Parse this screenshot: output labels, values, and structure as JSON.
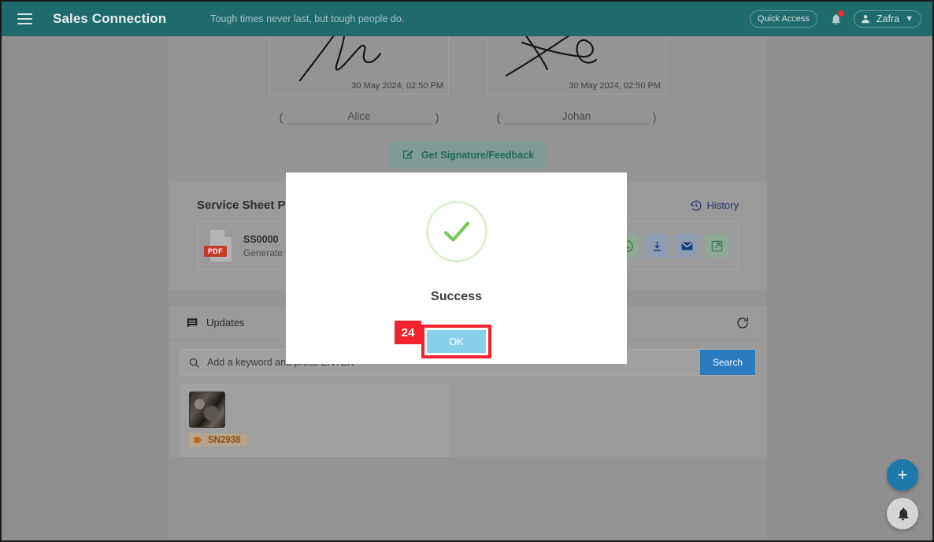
{
  "header": {
    "menu_icon": "hamburger-icon",
    "app_title": "Sales Connection",
    "quote": "Tough times never last, but tough people do.",
    "quick_access_label": "Quick Access",
    "bell_icon": "bell-icon",
    "user_name": "Zafra",
    "chevron": "⌄",
    "brand_color": "#1f6a6a"
  },
  "signatures": [
    {
      "timestamp": "30 May 2024, 02:50 PM",
      "name": "Alice",
      "open_paren": "(",
      "close_paren": ")"
    },
    {
      "timestamp": "30 May 2024, 02:50 PM",
      "name": "Johan",
      "open_paren": "(",
      "close_paren": ")"
    }
  ],
  "get_signature_button": {
    "label": "Get Signature/Feedback",
    "icon": "signature-edit-icon"
  },
  "service_sheet": {
    "title": "Service Sheet P",
    "history_label": "History",
    "history_icon": "history-clock-icon",
    "file": {
      "type_badge": "PDF",
      "name": "SS0000",
      "sub": "Generate",
      "actions": [
        {
          "name": "whatsapp-icon",
          "style": "green"
        },
        {
          "name": "download-icon",
          "style": "blue"
        },
        {
          "name": "email-icon",
          "style": "blue"
        },
        {
          "name": "open-external-icon",
          "style": "green"
        }
      ]
    }
  },
  "updates": {
    "title": "Updates",
    "title_icon": "comment-icon",
    "refresh_icon": "refresh-icon",
    "search": {
      "placeholder": "Add a keyword and press ENTER",
      "value": "",
      "icon": "search-icon",
      "button_label": "Search",
      "button_color": "#2a7ac0"
    },
    "items": [
      {
        "thumbnail": "machine-part-photo",
        "tag_icon": "tag-icon",
        "tag_label": "SN2938"
      }
    ]
  },
  "fabs": [
    {
      "name": "add-fab",
      "glyph": "+",
      "color": "#1d79ab"
    },
    {
      "name": "notification-fab",
      "glyph": "bell-icon",
      "color": "#d5d5d5"
    }
  ],
  "modal": {
    "status_icon": "success-check-icon",
    "title": "Success",
    "ok_label": "OK",
    "annotation_number": "24",
    "annotation_color": "#f5232f",
    "ok_button_color": "#87cfeb"
  }
}
